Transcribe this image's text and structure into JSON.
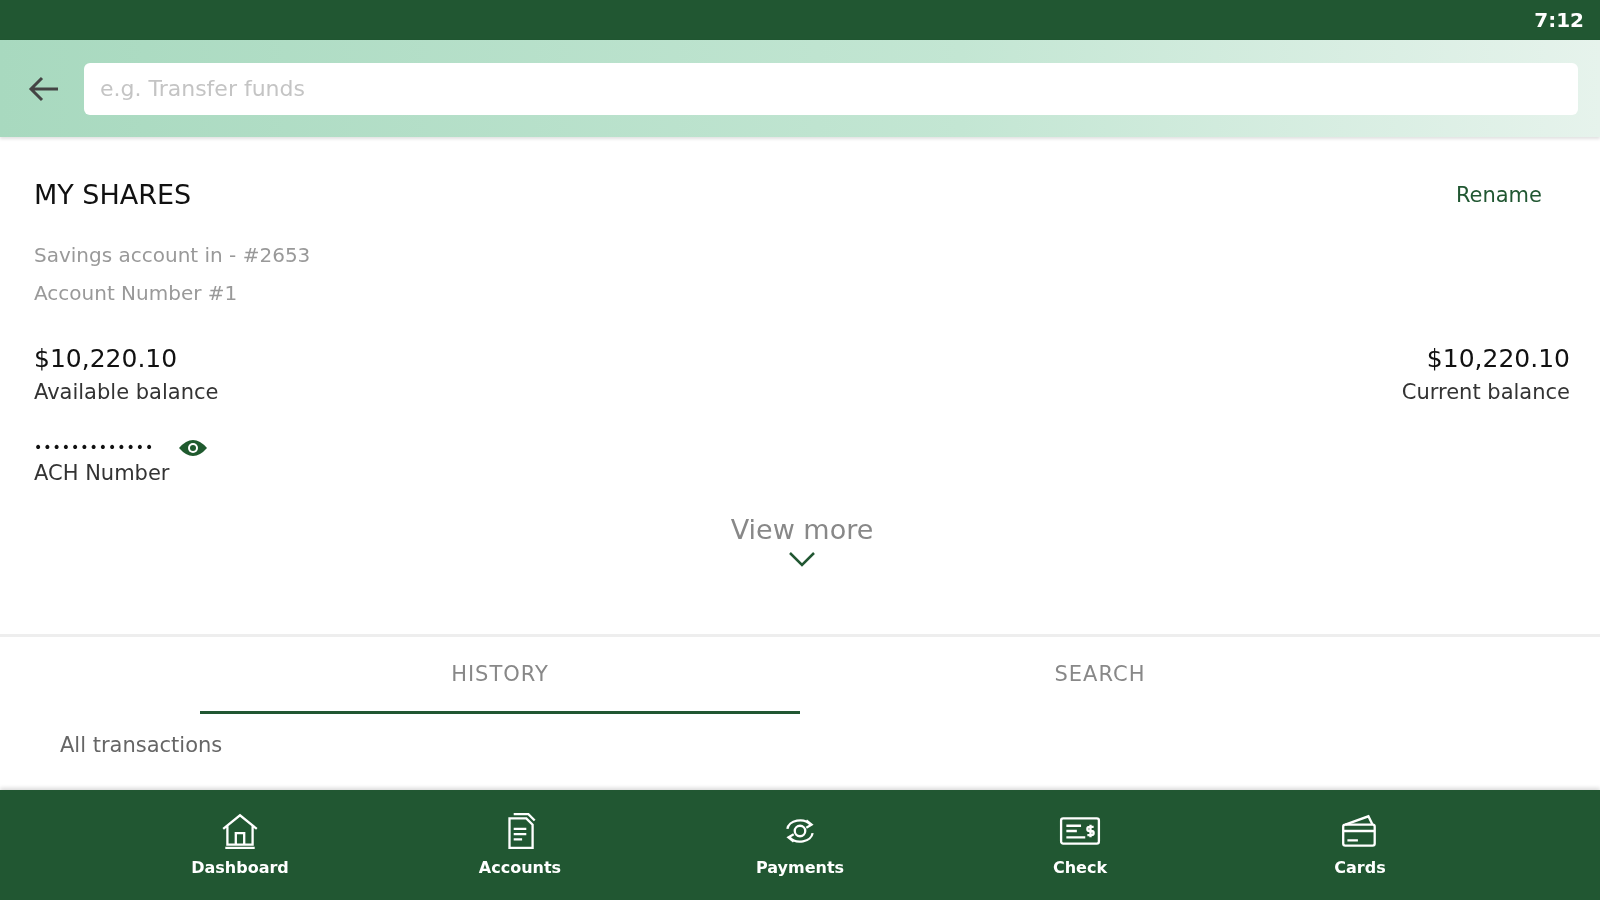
{
  "status_bar": {
    "time": "7:12"
  },
  "search": {
    "placeholder": "e.g. Transfer funds"
  },
  "account": {
    "title": "MY SHARES",
    "rename": "Rename",
    "subtitle": "Savings account in - #2653",
    "number": "Account Number #1",
    "balances": [
      {
        "amount": "$10,220.10",
        "label": "Available balance"
      },
      {
        "amount": "$10,220.10",
        "label": "Current balance"
      }
    ],
    "ach": {
      "masked": "•••••••••••••",
      "label": "ACH Number"
    },
    "view_more": "View more"
  },
  "tabs": [
    {
      "label": "HISTORY",
      "selected": true
    },
    {
      "label": "SEARCH",
      "selected": false
    }
  ],
  "list_heading": "All transactions",
  "nav": [
    {
      "label": "Dashboard",
      "kind": "home"
    },
    {
      "label": "Accounts",
      "kind": "document"
    },
    {
      "label": "Payments",
      "kind": "exchange"
    },
    {
      "label": "Check",
      "kind": "check"
    },
    {
      "label": "Cards",
      "kind": "cards"
    }
  ]
}
